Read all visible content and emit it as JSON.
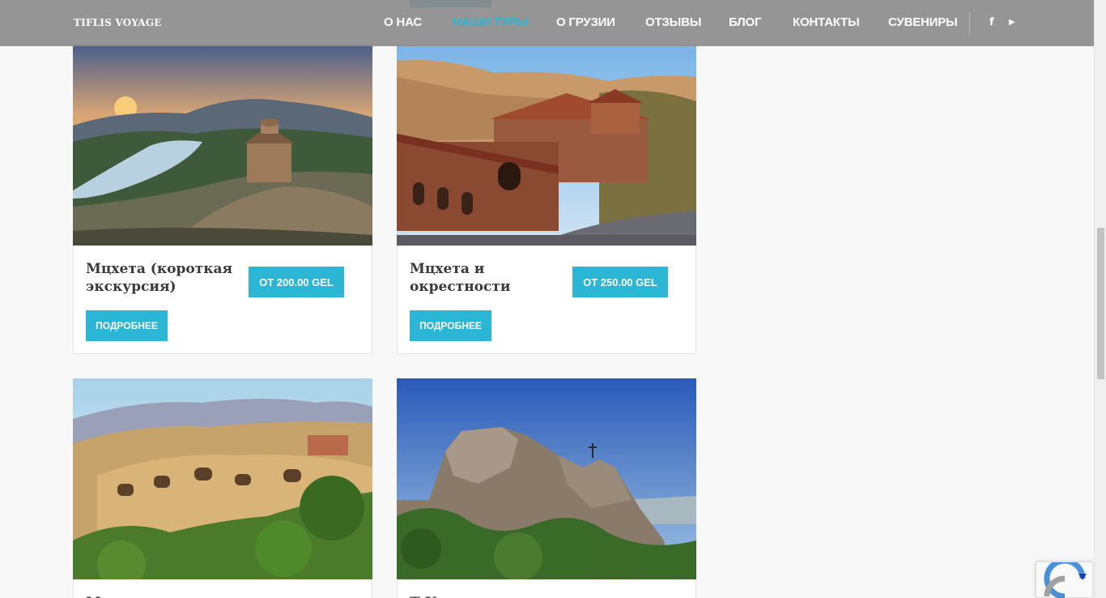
{
  "header": {
    "logo": "TIFLIS VOYAGE",
    "nav": [
      {
        "label": "О НАС",
        "active": false
      },
      {
        "label": "НАШИ ТУРЫ",
        "active": true
      },
      {
        "label": "О ГРУЗИИ",
        "active": false
      },
      {
        "label": "ОТЗЫВЫ",
        "active": false
      },
      {
        "label": "БЛОГ",
        "active": false
      },
      {
        "label": "КОНТАКТЫ",
        "active": false
      },
      {
        "label": "СУВЕНИРЫ",
        "active": false
      }
    ],
    "social": [
      {
        "icon": "facebook-icon",
        "glyph": "f"
      },
      {
        "icon": "youtube-icon",
        "glyph": "▶"
      }
    ]
  },
  "tours": [
    {
      "title": "Мцхета (короткая экскурсия)",
      "price": "ОТ 200.00 GEL",
      "more": "ПОДРОБНЕЕ"
    },
    {
      "title": "Мцхета и окрестности",
      "price": "ОТ 250.00 GEL",
      "more": "ПОДРОБНЕЕ"
    },
    {
      "title": "М",
      "price": "",
      "more": ""
    },
    {
      "title": "Т К",
      "price": "",
      "more": ""
    }
  ],
  "colors": {
    "accent": "#2cb6d6",
    "navbar": "#8c8c8c",
    "title_text": "#3a3a3a",
    "background": "#f8f8f8"
  }
}
